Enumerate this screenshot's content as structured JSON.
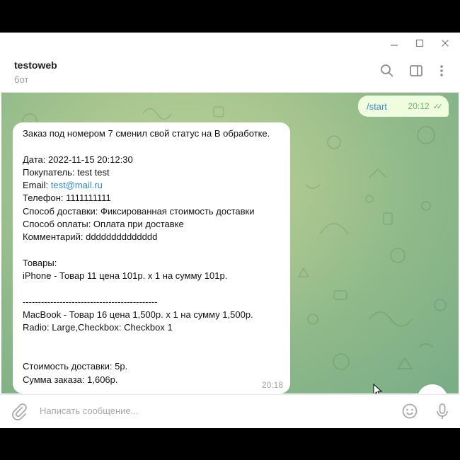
{
  "window": {
    "minimize_icon": "minimize-icon",
    "maximize_icon": "maximize-icon",
    "close_icon": "close-icon"
  },
  "header": {
    "title": "testoweb",
    "subtitle": "бот",
    "icons": [
      "search-icon",
      "sidebar-toggle-icon",
      "more-vertical-icon"
    ]
  },
  "messages": {
    "outgoing": {
      "text": "/start",
      "time": "20:12",
      "status": "read"
    },
    "incoming": {
      "lines": [
        "Заказ под номером 7 сменил свой статус на В обработке.",
        "",
        "Дата: 2022-11-15 20:12:30",
        "Покупатель: test test",
        "Email: ",
        "Телефон: 1111111111",
        "Способ доставки: Фиксированная стоимость доставки",
        "Способ оплаты: Оплата при доставке",
        "Комментарий: dddddddddddddd",
        "",
        "Товары:",
        "iPhone - Товар 11 цена 101р. х 1 на сумму 101р.",
        "",
        "--------------------------------------------",
        "MacBook - Товар 16 цена 1,500р. х 1 на сумму 1,500р.",
        "Radio: Large,Checkbox: Checkbox 1",
        "",
        "",
        "Стоимость доставки: 5р.",
        "Сумма заказа: 1,606р."
      ],
      "email_link": "test@mail.ru",
      "time": "20:18"
    }
  },
  "composer": {
    "placeholder": "Написать сообщение..."
  },
  "colors": {
    "out_bubble": "#effdde",
    "link": "#2b8ad4",
    "ticks": "#5fb157"
  }
}
